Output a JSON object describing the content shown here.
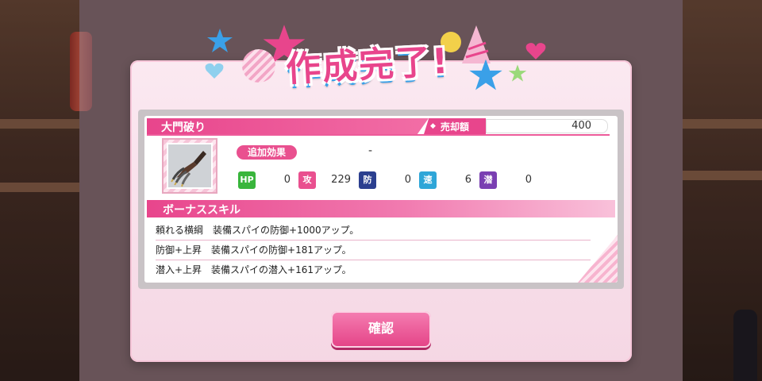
{
  "title": "作成完了!",
  "item": {
    "name": "大門破り",
    "sell_label": "売却額",
    "sell_value": "400",
    "effect_label": "追加効果",
    "effect_value": "-",
    "icon": "claw-weapon-icon"
  },
  "stats": [
    {
      "label": "HP",
      "value": "0",
      "color": "#39b53c"
    },
    {
      "label": "攻",
      "value": "229",
      "color": "#e9508f"
    },
    {
      "label": "防",
      "value": "0",
      "color": "#2b3f8f"
    },
    {
      "label": "速",
      "value": "6",
      "color": "#2ea6d8"
    },
    {
      "label": "潜",
      "value": "0",
      "color": "#7a3fb2"
    }
  ],
  "bonus_skill": {
    "header": "ボーナススキル",
    "rows": [
      "頼れる横綱　装備スパイの防御+1000アップ。",
      "防御+上昇　装備スパイの防御+181アップ。",
      "潜入+上昇　装備スパイの潜入+161アップ。"
    ]
  },
  "confirm_label": "確認",
  "colors": {
    "accent": "#e8458c",
    "title_shadow": "#3aa0e8"
  }
}
